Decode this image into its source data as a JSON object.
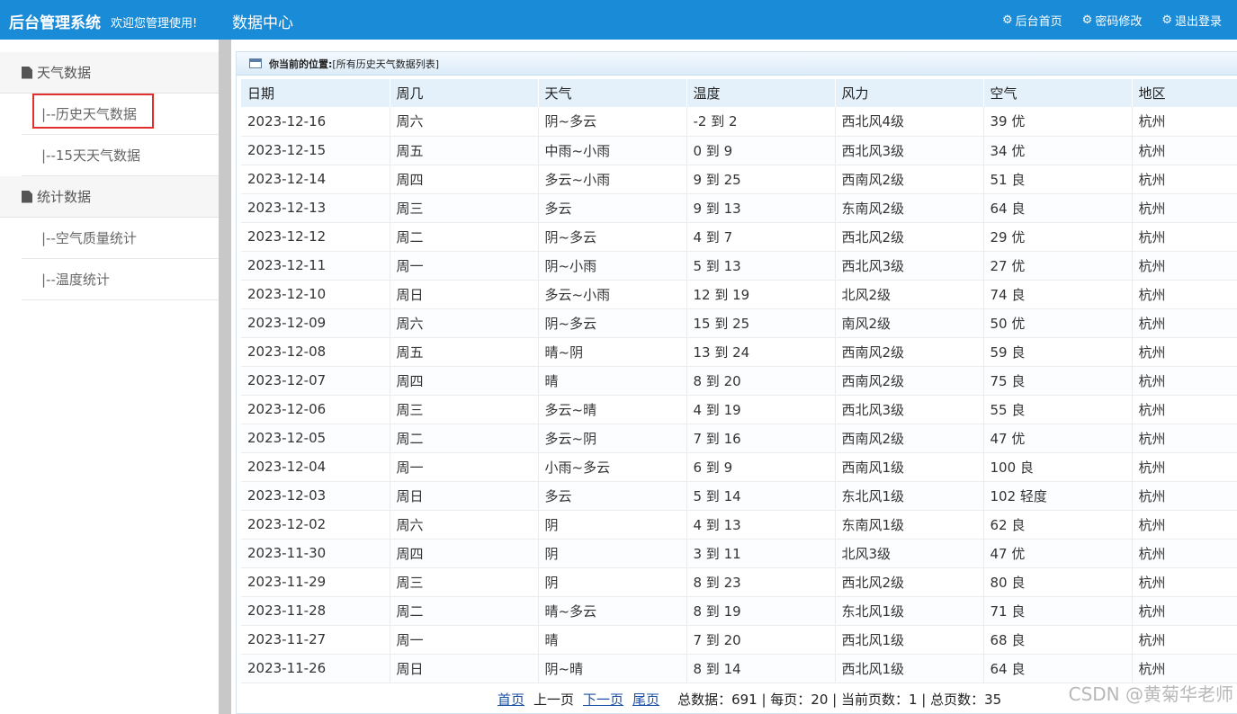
{
  "header": {
    "brand": "后台管理系统",
    "welcome": "欢迎您管理使用!",
    "center_title": "数据中心",
    "links": [
      {
        "label": "后台首页",
        "icon": "gear-icon"
      },
      {
        "label": "密码修改",
        "icon": "gear-icon"
      },
      {
        "label": "退出登录",
        "icon": "gear-icon"
      }
    ]
  },
  "sidebar": {
    "sections": [
      {
        "label": "天气数据",
        "items": [
          "|--历史天气数据",
          "|--15天天气数据"
        ]
      },
      {
        "label": "统计数据",
        "items": [
          "|--空气质量统计",
          "|--温度统计"
        ]
      }
    ]
  },
  "location": {
    "label": "你当前的位置:",
    "path": "[所有历史天气数据列表]"
  },
  "table": {
    "headers": [
      "日期",
      "周几",
      "天气",
      "温度",
      "风力",
      "空气",
      "地区"
    ],
    "rows": [
      [
        "2023-12-16",
        "周六",
        "阴~多云",
        "-2 到 2",
        "西北风4级",
        "39 优",
        "杭州"
      ],
      [
        "2023-12-15",
        "周五",
        "中雨~小雨",
        "0 到 9",
        "西北风3级",
        "34 优",
        "杭州"
      ],
      [
        "2023-12-14",
        "周四",
        "多云~小雨",
        "9 到 25",
        "西南风2级",
        "51 良",
        "杭州"
      ],
      [
        "2023-12-13",
        "周三",
        "多云",
        "9 到 13",
        "东南风2级",
        "64 良",
        "杭州"
      ],
      [
        "2023-12-12",
        "周二",
        "阴~多云",
        "4 到 7",
        "西北风2级",
        "29 优",
        "杭州"
      ],
      [
        "2023-12-11",
        "周一",
        "阴~小雨",
        "5 到 13",
        "西北风3级",
        "27 优",
        "杭州"
      ],
      [
        "2023-12-10",
        "周日",
        "多云~小雨",
        "12 到 19",
        "北风2级",
        "74 良",
        "杭州"
      ],
      [
        "2023-12-09",
        "周六",
        "阴~多云",
        "15 到 25",
        "南风2级",
        "50 优",
        "杭州"
      ],
      [
        "2023-12-08",
        "周五",
        "晴~阴",
        "13 到 24",
        "西南风2级",
        "59 良",
        "杭州"
      ],
      [
        "2023-12-07",
        "周四",
        "晴",
        "8 到 20",
        "西南风2级",
        "75 良",
        "杭州"
      ],
      [
        "2023-12-06",
        "周三",
        "多云~晴",
        "4 到 19",
        "西北风3级",
        "55 良",
        "杭州"
      ],
      [
        "2023-12-05",
        "周二",
        "多云~阴",
        "7 到 16",
        "西南风2级",
        "47 优",
        "杭州"
      ],
      [
        "2023-12-04",
        "周一",
        "小雨~多云",
        "6 到 9",
        "西南风1级",
        "100 良",
        "杭州"
      ],
      [
        "2023-12-03",
        "周日",
        "多云",
        "5 到 14",
        "东北风1级",
        "102 轻度",
        "杭州"
      ],
      [
        "2023-12-02",
        "周六",
        "阴",
        "4 到 13",
        "东南风1级",
        "62 良",
        "杭州"
      ],
      [
        "2023-11-30",
        "周四",
        "阴",
        "3 到 11",
        "北风3级",
        "47 优",
        "杭州"
      ],
      [
        "2023-11-29",
        "周三",
        "阴",
        "8 到 23",
        "西北风2级",
        "80 良",
        "杭州"
      ],
      [
        "2023-11-28",
        "周二",
        "晴~多云",
        "8 到 19",
        "东北风1级",
        "71 良",
        "杭州"
      ],
      [
        "2023-11-27",
        "周一",
        "晴",
        "7 到 20",
        "西北风1级",
        "68 良",
        "杭州"
      ],
      [
        "2023-11-26",
        "周日",
        "阴~晴",
        "8 到 14",
        "西北风1级",
        "64 良",
        "杭州"
      ]
    ]
  },
  "pager": {
    "first": "首页",
    "prev": "上一页",
    "next": "下一页",
    "last": "尾页",
    "stats": "总数据：691 | 每页：20 | 当前页数：1 | 总页数：35"
  },
  "watermark": "CSDN @黄菊华老师",
  "colors": {
    "topbar": "#1a8bd6",
    "active_highlight": "#e0302e",
    "link": "#1b4fa6"
  }
}
